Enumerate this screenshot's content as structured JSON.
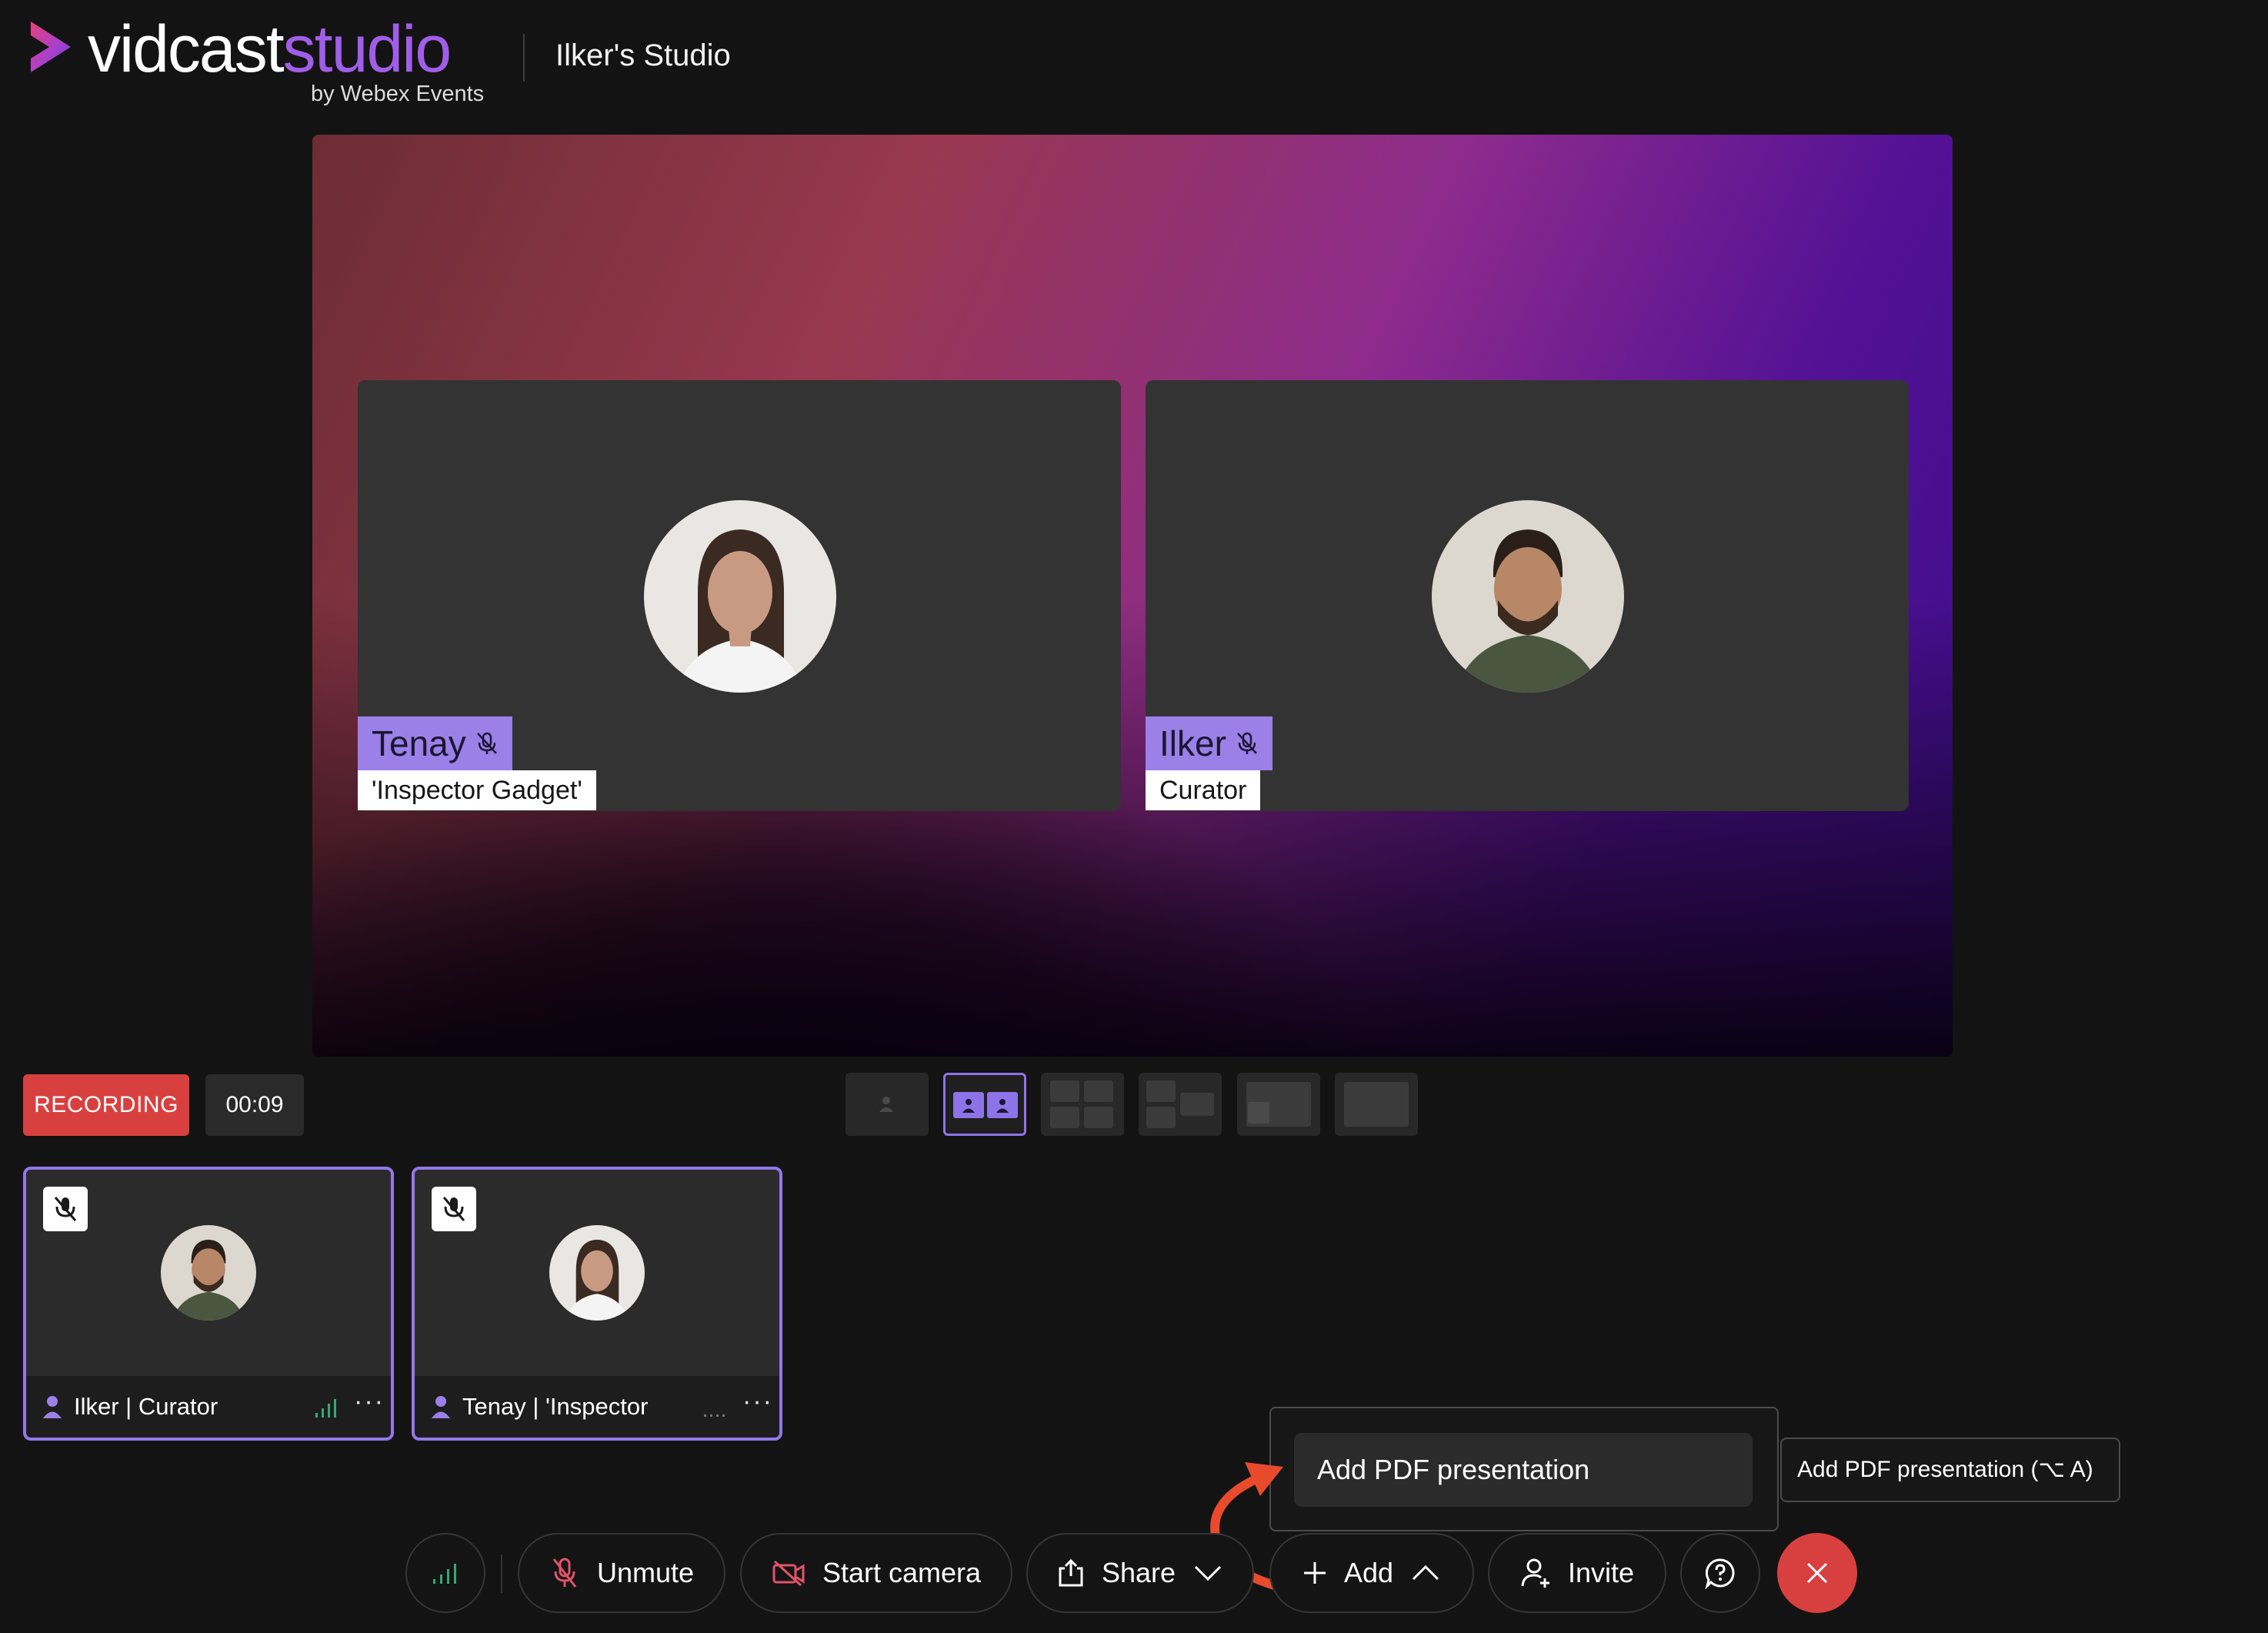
{
  "app": {
    "logo_word1": "vidcast",
    "logo_word2": "studio",
    "logo_sub": "by Webex Events",
    "studio_title": "Ilker's Studio"
  },
  "stage": {
    "participants": [
      {
        "name": "Tenay",
        "role": "'Inspector Gadget'",
        "muted": true
      },
      {
        "name": "Ilker",
        "role": "Curator",
        "muted": true
      }
    ]
  },
  "recording": {
    "label": "RECORDING",
    "timer": "00:09"
  },
  "layouts": {
    "options": [
      "single",
      "two-up",
      "grid",
      "side-by-side",
      "screen-with-person",
      "blank"
    ],
    "active": "two-up"
  },
  "participants_panel": [
    {
      "name": "Ilker",
      "role": "Curator",
      "display": "Ilker | Curator",
      "muted": true
    },
    {
      "name": "Tenay",
      "role": "'Inspector",
      "display": "Tenay | 'Inspector",
      "muted": true
    }
  ],
  "add_menu": {
    "item": "Add PDF presentation",
    "tooltip": "Add PDF presentation (⌥ A)"
  },
  "toolbar": {
    "unmute": "Unmute",
    "start_camera": "Start camera",
    "share": "Share",
    "add": "Add",
    "invite": "Invite"
  },
  "colors": {
    "accent": "#9b80e8",
    "record": "#d8403f",
    "annotation_arrow": "#e84a2c"
  }
}
